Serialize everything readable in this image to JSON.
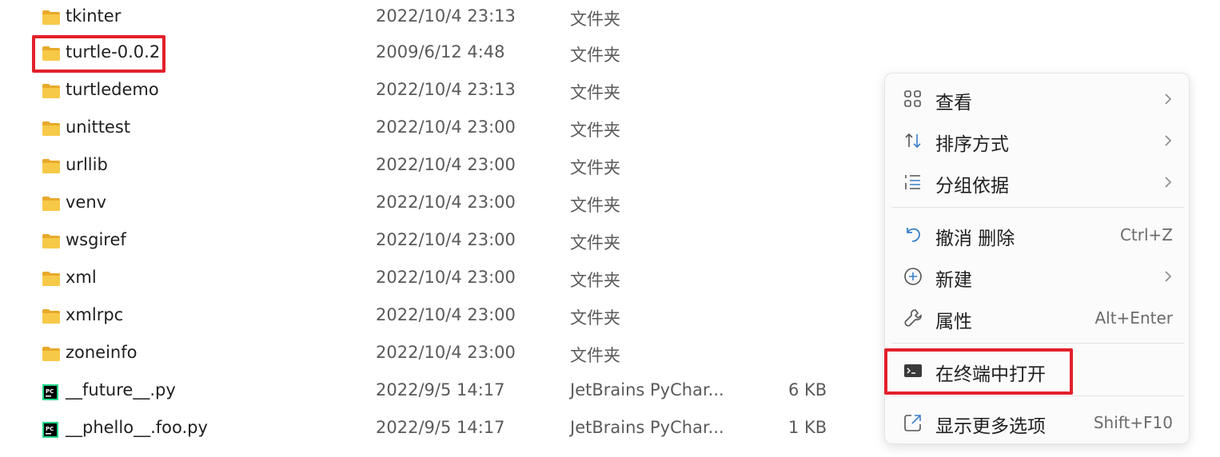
{
  "files": [
    {
      "name": "tkinter",
      "date": "2022/10/4 23:13",
      "type": "文件夹",
      "size": "",
      "icon": "folder-icon"
    },
    {
      "name": "turtle-0.0.2",
      "date": "2009/6/12 4:48",
      "type": "文件夹",
      "size": "",
      "icon": "folder-icon"
    },
    {
      "name": "turtledemo",
      "date": "2022/10/4 23:13",
      "type": "文件夹",
      "size": "",
      "icon": "folder-icon"
    },
    {
      "name": "unittest",
      "date": "2022/10/4 23:00",
      "type": "文件夹",
      "size": "",
      "icon": "folder-icon"
    },
    {
      "name": "urllib",
      "date": "2022/10/4 23:00",
      "type": "文件夹",
      "size": "",
      "icon": "folder-icon"
    },
    {
      "name": "venv",
      "date": "2022/10/4 23:00",
      "type": "文件夹",
      "size": "",
      "icon": "folder-icon"
    },
    {
      "name": "wsgiref",
      "date": "2022/10/4 23:00",
      "type": "文件夹",
      "size": "",
      "icon": "folder-icon"
    },
    {
      "name": "xml",
      "date": "2022/10/4 23:00",
      "type": "文件夹",
      "size": "",
      "icon": "folder-icon"
    },
    {
      "name": "xmlrpc",
      "date": "2022/10/4 23:00",
      "type": "文件夹",
      "size": "",
      "icon": "folder-icon"
    },
    {
      "name": "zoneinfo",
      "date": "2022/10/4 23:00",
      "type": "文件夹",
      "size": "",
      "icon": "folder-icon"
    },
    {
      "name": "__future__.py",
      "date": "2022/9/5 14:17",
      "type": "JetBrains PyChar...",
      "size": "6 KB",
      "icon": "pycharm-file-icon"
    },
    {
      "name": "__phello__.foo.py",
      "date": "2022/9/5 14:17",
      "type": "JetBrains PyChar...",
      "size": "1 KB",
      "icon": "pycharm-file-icon"
    }
  ],
  "context_menu": {
    "items": [
      {
        "label": "查看",
        "shortcut": "",
        "submenu": true,
        "icon": "view-grid-icon"
      },
      {
        "label": "排序方式",
        "shortcut": "",
        "submenu": true,
        "icon": "sort-icon"
      },
      {
        "label": "分组依据",
        "shortcut": "",
        "submenu": true,
        "icon": "group-by-icon"
      },
      {
        "label": "撤消 删除",
        "shortcut": "Ctrl+Z",
        "submenu": false,
        "icon": "undo-icon"
      },
      {
        "label": "新建",
        "shortcut": "",
        "submenu": true,
        "icon": "new-plus-icon"
      },
      {
        "label": "属性",
        "shortcut": "Alt+Enter",
        "submenu": false,
        "icon": "wrench-icon"
      },
      {
        "label": "在终端中打开",
        "shortcut": "",
        "submenu": false,
        "icon": "terminal-icon"
      },
      {
        "label": "显示更多选项",
        "shortcut": "Shift+F10",
        "submenu": false,
        "icon": "share-external-icon"
      }
    ]
  },
  "colors": {
    "highlight": "#e3202b",
    "folder": "#f4c542",
    "accent_icon": "#3a7fc8"
  }
}
